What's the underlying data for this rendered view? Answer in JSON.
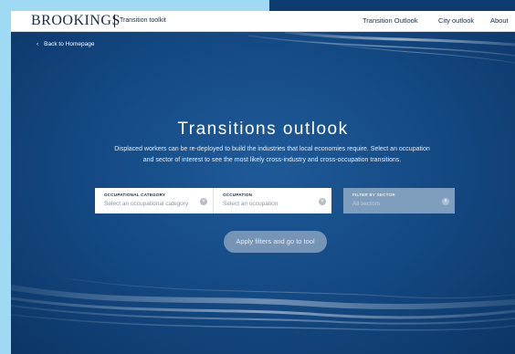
{
  "header": {
    "brand": "BROOKINGS",
    "subtitle": "Transition toolkit",
    "nav": [
      "Transition Outlook",
      "City outlook",
      "About"
    ]
  },
  "back_link": "Back to Homepage",
  "hero": {
    "title": "Transitions outlook",
    "description": "Displaced workers can be re-deployed to build the industries that local economies require. Select an occupation and sector of interest to see the most likely cross-industry and cross-occupation transitions."
  },
  "filters": {
    "category": {
      "label": "OCCUPATIONAL CATEGORY",
      "placeholder": "Select an occupational category"
    },
    "occupation": {
      "label": "OCCUPATION",
      "placeholder": "Select an occupation"
    },
    "sector": {
      "label": "FILTER BY SECTOR",
      "placeholder": "All sectors"
    }
  },
  "apply_button": "Apply filters and go to tool",
  "colors": {
    "accent_strip": "#9fd9f4",
    "hero_bg": "#164d88",
    "button_bg": "#7694b5"
  }
}
